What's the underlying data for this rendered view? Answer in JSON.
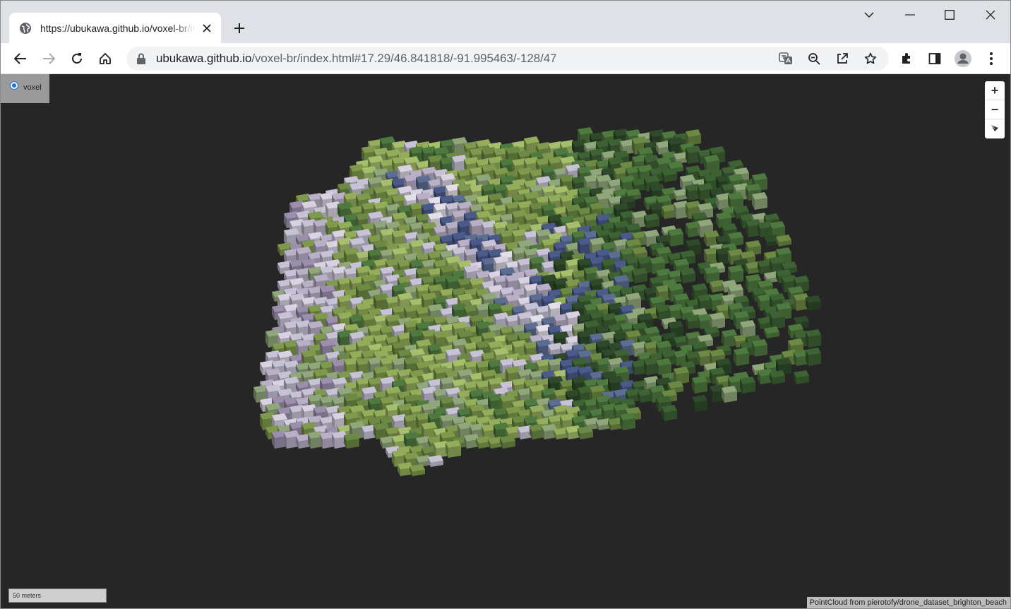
{
  "browser": {
    "tab_title": "https://ubukawa.github.io/voxel-br/index.html#17.29/46.841818/-91.995463/-128/47",
    "url_host": "ubukawa.github.io",
    "url_path": "/voxel-br/index.html#17.29/46.841818/-91.995463/-128/47"
  },
  "toolbar_icons": [
    "back-icon",
    "forward-icon",
    "reload-icon",
    "home-icon",
    "lock-icon",
    "translate-icon",
    "zoom-out-icon",
    "share-icon",
    "star-icon",
    "extensions-icon",
    "side-panel-icon",
    "profile-icon",
    "menu-icon"
  ],
  "map": {
    "layer_label": "voxel",
    "layer_selected": true,
    "zoom_in": "+",
    "zoom_out": "−",
    "scale_label": "50 meters",
    "attribution": "PointCloud from pierotofy/drone_dataset_brighton_beach"
  },
  "colors": {
    "map_background": "#262626",
    "voxel_palette": [
      "#7f9a4c",
      "#93ad5a",
      "#6d8a45",
      "#a6bf6c",
      "#c7c2d6",
      "#b9b0c8",
      "#d8d2e2",
      "#5b6d93",
      "#4a5a8a",
      "#4f7a3f",
      "#3d6233",
      "#2e4a2a",
      "#8fa77a",
      "#9c8fae",
      "#e4e0ea"
    ]
  }
}
